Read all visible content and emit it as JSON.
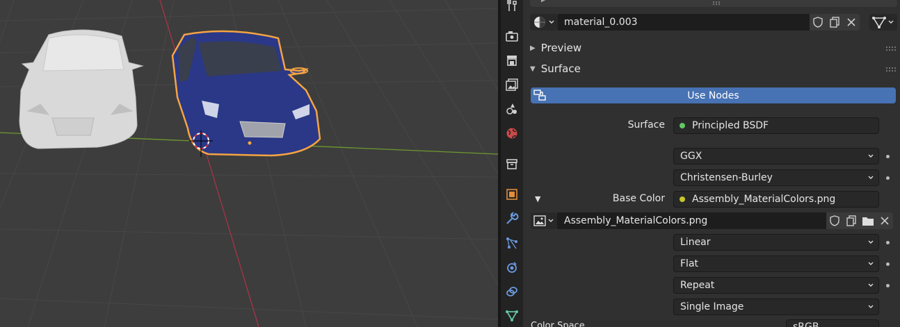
{
  "material": {
    "name": "material_0.003",
    "preview_label": "Preview",
    "surface_label": "Surface",
    "use_nodes_label": "Use Nodes"
  },
  "surface_settings": {
    "surface_label": "Surface",
    "surface_value": "Principled BSDF",
    "distribution": "GGX",
    "subsurface_method": "Christensen-Burley",
    "base_color_label": "Base Color",
    "base_color_value": "Assembly_MaterialColors.png"
  },
  "image_texture": {
    "image_name": "Assembly_MaterialColors.png",
    "interpolation": "Linear",
    "projection": "Flat",
    "extension": "Repeat",
    "source": "Single Image",
    "color_space_label": "Color Space",
    "color_space_value": "sRGB"
  },
  "colors": {
    "accent_blue": "#4772b3",
    "selection_orange": "#f5a443",
    "socket_green": "#63c763",
    "socket_yellow": "#c7c729",
    "x_axis": "#a8334b",
    "y_axis": "#6e9a2f"
  },
  "tabs": [
    "tool-icon",
    "render-icon",
    "output-icon",
    "view-layer-icon",
    "scene-icon",
    "world-icon",
    "collection-icon",
    "object-icon",
    "modifier-icon",
    "particles-icon",
    "physics-icon",
    "constraints-icon",
    "data-icon"
  ]
}
